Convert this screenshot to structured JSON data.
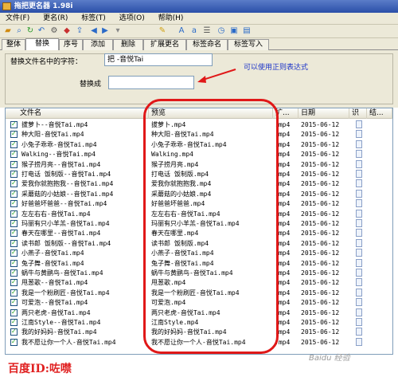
{
  "window": {
    "title": "拖把更名器 1.98i"
  },
  "menu": [
    "文件(F)",
    "更名(R)",
    "标签(T)",
    "选项(O)",
    "帮助(H)"
  ],
  "tabs": [
    "整体",
    "替换",
    "序号",
    "添加",
    "删除",
    "扩展更名",
    "标签命名",
    "标签写入"
  ],
  "active_tab": "替换",
  "replace": {
    "find_label": "替换文件名中的字符：",
    "find_value": "把 -音悦Tai",
    "replace_label": "替换成",
    "replace_value": "",
    "note": "可以使用正则表达式"
  },
  "columns": [
    "文件名",
    "预览",
    "扩...",
    "日期",
    "识",
    "结..."
  ],
  "rows": [
    {
      "name": "拔萝卜--音悦Tai.mp4",
      "preview": "拔萝卜.mp4",
      "ext": ".mp4",
      "date": "2015-06-12"
    },
    {
      "name": "种大阳-音悦Tai.mp4",
      "preview": "种大阳-音悦Tai.mp4",
      "ext": ".mp4",
      "date": "2015-06-12"
    },
    {
      "name": "小兔子乖乖-音悦Tai.mp4",
      "preview": "小兔子乖乖-音悦Tai.mp4",
      "ext": ".mp4",
      "date": "2015-06-12"
    },
    {
      "name": "Walking--音悦Tai.mp4",
      "preview": "Walking.mp4",
      "ext": ".mp4",
      "date": "2015-06-12"
    },
    {
      "name": "猴子捞月亮--音悦Tai.mp4",
      "preview": "猴子捞月亮.mp4",
      "ext": ".mp4",
      "date": "2015-06-12"
    },
    {
      "name": "打电话 饭制版--音悦Tai.mp4",
      "preview": "打电话 饭制版.mp4",
      "ext": ".mp4",
      "date": "2015-06-12"
    },
    {
      "name": "爱我你就抱抱我--音悦Tai.mp4",
      "preview": "爱我你就抱抱我.mp4",
      "ext": ".mp4",
      "date": "2015-06-12"
    },
    {
      "name": "采蘑菇的小姑娘--音悦Tai.mp4",
      "preview": "采蘑菇的小姑娘.mp4",
      "ext": ".mp4",
      "date": "2015-06-12"
    },
    {
      "name": "好爸爸坏爸爸--音悦Tai.mp4",
      "preview": "好爸爸坏爸爸.mp4",
      "ext": ".mp4",
      "date": "2015-06-12"
    },
    {
      "name": "左左右右-音悦Tai.mp4",
      "preview": "左左右右-音悦Tai.mp4",
      "ext": ".mp4",
      "date": "2015-06-12"
    },
    {
      "name": "玛丽有只小羊羔-音悦Tai.mp4",
      "preview": "玛丽有只小羊羔-音悦Tai.mp4",
      "ext": ".mp4",
      "date": "2015-06-12"
    },
    {
      "name": "春天在哪里--音悦Tai.mp4",
      "preview": "春天在哪里.mp4",
      "ext": ".mp4",
      "date": "2015-06-12"
    },
    {
      "name": "读书郎 饭制版--音悦Tai.mp4",
      "preview": "读书郎 饭制版.mp4",
      "ext": ".mp4",
      "date": "2015-06-12"
    },
    {
      "name": "小燕子-音悦Tai.mp4",
      "preview": "小燕子-音悦Tai.mp4",
      "ext": ".mp4",
      "date": "2015-06-12"
    },
    {
      "name": "兔子舞-音悦Tai.mp4",
      "preview": "兔子舞-音悦Tai.mp4",
      "ext": ".mp4",
      "date": "2015-06-12"
    },
    {
      "name": "蜗牛与黄鹂鸟-音悦Tai.mp4",
      "preview": "蜗牛与黄鹂鸟-音悦Tai.mp4",
      "ext": ".mp4",
      "date": "2015-06-12"
    },
    {
      "name": "甩葱歌--音悦Tai.mp4",
      "preview": "甩葱歌.mp4",
      "ext": ".mp4",
      "date": "2015-06-12"
    },
    {
      "name": "我是一个粉刷匠-音悦Tai.mp4",
      "preview": "我是一个粉刷匠-音悦Tai.mp4",
      "ext": ".mp4",
      "date": "2015-06-12"
    },
    {
      "name": "可爱泡--音悦Tai.mp4",
      "preview": "可爱泡.mp4",
      "ext": ".mp4",
      "date": "2015-06-12"
    },
    {
      "name": "两只老虎-音悦Tai.mp4",
      "preview": "两只老虎-音悦Tai.mp4",
      "ext": ".mp4",
      "date": "2015-06-12"
    },
    {
      "name": "江南Style--音悦Tai.mp4",
      "preview": "江南Style.mp4",
      "ext": ".mp4",
      "date": "2015-06-12"
    },
    {
      "name": "我的好妈妈-音悦Tai.mp4",
      "preview": "我的好妈妈-音悦Tai.mp4",
      "ext": ".mp4",
      "date": "2015-06-12"
    },
    {
      "name": "我不愿让你一个人-音悦Tai.mp4",
      "preview": "我不愿让你一个人-音悦Tai.mp4",
      "ext": ".mp4",
      "date": "2015-06-12"
    }
  ],
  "footer_label": "百度ID:咗噤",
  "watermark": "Baidu 经验",
  "colors": {
    "annotation_red": "#e01818",
    "note_blue": "#1a32c8"
  }
}
